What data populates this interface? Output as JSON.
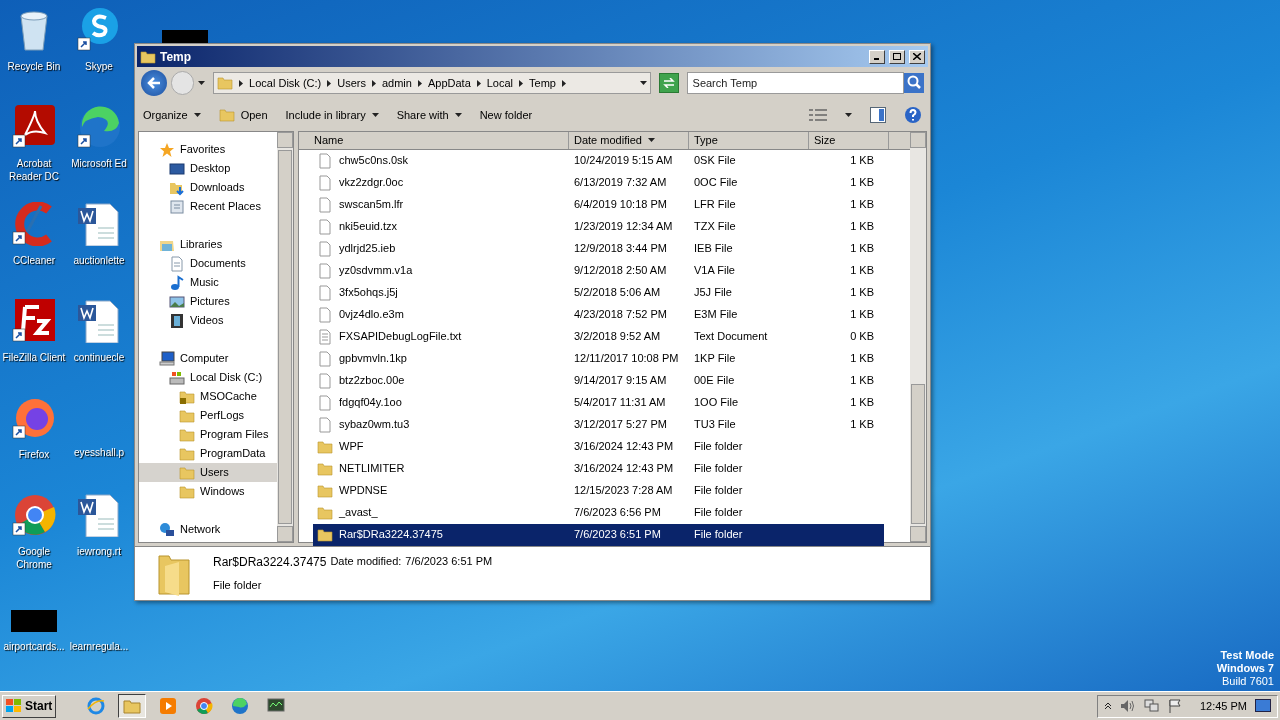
{
  "desktop": {
    "left_column": [
      {
        "label": "Recycle Bin",
        "kind": "recycle"
      },
      {
        "label": "Acrobat Reader DC",
        "kind": "acrobat"
      },
      {
        "label": "CCleaner",
        "kind": "ccleaner"
      },
      {
        "label": "FileZilla Client",
        "kind": "filezilla"
      },
      {
        "label": "Firefox",
        "kind": "firefox"
      },
      {
        "label": "Google Chrome",
        "kind": "chrome"
      },
      {
        "label": "airportcards...",
        "kind": "redacted"
      }
    ],
    "right_column": [
      {
        "label": "Skype",
        "kind": "skype"
      },
      {
        "label": "Microsoft Ed",
        "kind": "edge"
      },
      {
        "label": "auctionlette",
        "kind": "word"
      },
      {
        "label": "continuecle",
        "kind": "word"
      },
      {
        "label": "eyesshall.p",
        "kind": "blank"
      },
      {
        "label": "iewrong.rt",
        "kind": "word"
      },
      {
        "label": "learnregula...",
        "kind": "blank"
      }
    ]
  },
  "window": {
    "title": "Temp",
    "breadcrumb": [
      "Local Disk (C:)",
      "Users",
      "admin",
      "AppData",
      "Local",
      "Temp"
    ],
    "search": {
      "placeholder": "Search Temp"
    },
    "toolbar": [
      {
        "label": "Organize",
        "dropdown": true,
        "kind": "plain"
      },
      {
        "label": "Open",
        "dropdown": false,
        "kind": "open"
      },
      {
        "label": "Include in library",
        "dropdown": true,
        "kind": "plain"
      },
      {
        "label": "Share with",
        "dropdown": true,
        "kind": "plain"
      },
      {
        "label": "New folder",
        "dropdown": false,
        "kind": "plain"
      }
    ],
    "nav": [
      {
        "label": "Favorites",
        "kind": "star",
        "selected": false,
        "children": [
          {
            "label": "Desktop",
            "kind": "desktop",
            "selected": false
          },
          {
            "label": "Downloads",
            "kind": "downloads",
            "selected": false
          },
          {
            "label": "Recent Places",
            "kind": "recent",
            "selected": false
          }
        ]
      },
      {
        "label": "Libraries",
        "kind": "library",
        "selected": false,
        "children": [
          {
            "label": "Documents",
            "kind": "document",
            "selected": false
          },
          {
            "label": "Music",
            "kind": "music",
            "selected": false
          },
          {
            "label": "Pictures",
            "kind": "pictures",
            "selected": false
          },
          {
            "label": "Videos",
            "kind": "videos",
            "selected": false
          }
        ]
      },
      {
        "label": "Computer",
        "kind": "computer",
        "selected": false,
        "children": [
          {
            "label": "Local Disk (C:)",
            "kind": "disk",
            "selected": false,
            "children": [
              {
                "label": "MSOCache",
                "kind": "locked",
                "selected": false
              },
              {
                "label": "PerfLogs",
                "kind": "folder",
                "selected": false
              },
              {
                "label": "Program Files",
                "kind": "folder",
                "selected": false
              },
              {
                "label": "ProgramData",
                "kind": "folder",
                "selected": false
              },
              {
                "label": "Users",
                "kind": "folder",
                "selected": true
              },
              {
                "label": "Windows",
                "kind": "folder",
                "selected": false
              }
            ]
          }
        ]
      },
      {
        "label": "Network",
        "kind": "network",
        "selected": false
      }
    ],
    "columns": [
      {
        "label": "Name",
        "sorted": false
      },
      {
        "label": "Date modified",
        "sorted": true
      },
      {
        "label": "Type",
        "sorted": false
      },
      {
        "label": "Size",
        "sorted": false
      }
    ],
    "rows": [
      {
        "name": "chw5c0ns.0sk",
        "date": "10/24/2019 5:15 AM",
        "type": "0SK File",
        "size": "1 KB",
        "kind": "file",
        "selected": false
      },
      {
        "name": "vkz2zdgr.0oc",
        "date": "6/13/2019 7:32 AM",
        "type": "0OC File",
        "size": "1 KB",
        "kind": "file",
        "selected": false
      },
      {
        "name": "swscan5m.lfr",
        "date": "6/4/2019 10:18 PM",
        "type": "LFR File",
        "size": "1 KB",
        "kind": "file",
        "selected": false
      },
      {
        "name": "nki5euid.tzx",
        "date": "1/23/2019 12:34 AM",
        "type": "TZX File",
        "size": "1 KB",
        "kind": "file",
        "selected": false
      },
      {
        "name": "ydlrjd25.ieb",
        "date": "12/9/2018 3:44 PM",
        "type": "IEB File",
        "size": "1 KB",
        "kind": "file",
        "selected": false
      },
      {
        "name": "yz0sdvmm.v1a",
        "date": "9/12/2018 2:50 AM",
        "type": "V1A File",
        "size": "1 KB",
        "kind": "file",
        "selected": false
      },
      {
        "name": "3fx5ohqs.j5j",
        "date": "5/2/2018 5:06 AM",
        "type": "J5J File",
        "size": "1 KB",
        "kind": "file",
        "selected": false
      },
      {
        "name": "0vjz4dlo.e3m",
        "date": "4/23/2018 7:52 PM",
        "type": "E3M File",
        "size": "1 KB",
        "kind": "file",
        "selected": false
      },
      {
        "name": "FXSAPIDebugLogFile.txt",
        "date": "3/2/2018 9:52 AM",
        "type": "Text Document",
        "size": "0 KB",
        "kind": "text",
        "selected": false
      },
      {
        "name": "gpbvmvln.1kp",
        "date": "12/11/2017 10:08 PM",
        "type": "1KP File",
        "size": "1 KB",
        "kind": "file",
        "selected": false
      },
      {
        "name": "btz2zboc.00e",
        "date": "9/14/2017 9:15 AM",
        "type": "00E File",
        "size": "1 KB",
        "kind": "file",
        "selected": false
      },
      {
        "name": "fdgqf04y.1oo",
        "date": "5/4/2017 11:31 AM",
        "type": "1OO File",
        "size": "1 KB",
        "kind": "file",
        "selected": false
      },
      {
        "name": "sybaz0wm.tu3",
        "date": "3/12/2017 5:27 PM",
        "type": "TU3 File",
        "size": "1 KB",
        "kind": "file",
        "selected": false
      },
      {
        "name": "WPF",
        "date": "3/16/2024 12:43 PM",
        "type": "File folder",
        "kind": "folder",
        "selected": false
      },
      {
        "name": "NETLIMITER",
        "date": "3/16/2024 12:43 PM",
        "type": "File folder",
        "kind": "folder",
        "selected": false
      },
      {
        "name": "WPDNSE",
        "date": "12/15/2023 7:28 AM",
        "type": "File folder",
        "kind": "folder",
        "selected": false
      },
      {
        "name": "_avast_",
        "date": "7/6/2023 6:56 PM",
        "type": "File folder",
        "kind": "folder",
        "selected": false
      },
      {
        "name": "Rar$DRa3224.37475",
        "date": "7/6/2023 6:51 PM",
        "type": "File folder",
        "kind": "folder",
        "selected": true
      }
    ],
    "details": {
      "name": "Rar$DRa3224.37475",
      "date_label": "Date modified:",
      "date": "7/6/2023 6:51 PM",
      "type": "File folder"
    }
  },
  "watermark_os": [
    "Test Mode",
    "Windows 7",
    "Build 7601"
  ],
  "taskbar": {
    "start": "Start",
    "apps": [
      {
        "kind": "ie",
        "selected": false
      },
      {
        "kind": "explorer",
        "selected": true
      },
      {
        "kind": "media",
        "selected": false
      },
      {
        "kind": "chrome",
        "selected": false
      },
      {
        "kind": "edge",
        "selected": false
      },
      {
        "kind": "monitor",
        "selected": false
      }
    ],
    "time": "12:45 PM"
  }
}
